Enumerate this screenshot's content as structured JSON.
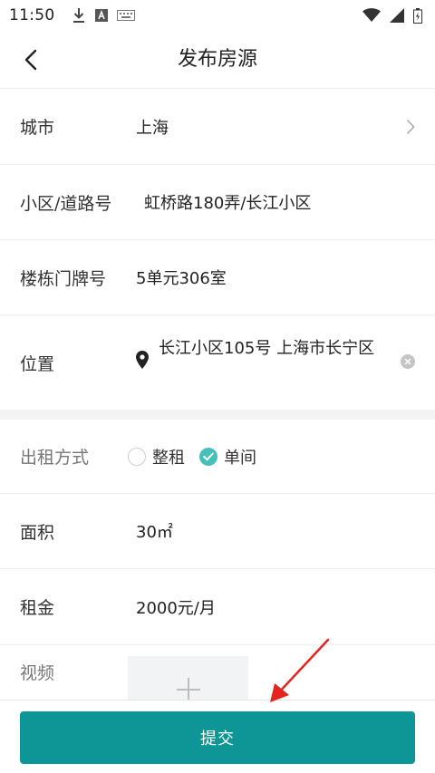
{
  "status_bar": {
    "time": "11:50",
    "left_icons": [
      "download-icon",
      "a-badge-icon",
      "keyboard-icon"
    ],
    "right_icons": [
      "wifi-icon",
      "signal-icon",
      "battery-icon"
    ]
  },
  "nav": {
    "title": "发布房源",
    "back_icon": "chevron-left-icon"
  },
  "form": {
    "city": {
      "label": "城市",
      "value": "上海"
    },
    "community": {
      "label": "小区/道路号",
      "value": "虹桥路180弄/长江小区"
    },
    "building": {
      "label": "楼栋门牌号",
      "value": "5单元306室"
    },
    "location": {
      "label": "位置",
      "value": "长江小区105号 上海市长宁区"
    },
    "rental_mode": {
      "label": "出租方式",
      "options": [
        "整租",
        "单间"
      ],
      "selected": "单间"
    },
    "area": {
      "label": "面积",
      "value": "30㎡"
    },
    "rent": {
      "label": "租金",
      "value": "2000元/月"
    },
    "video": {
      "label": "视频"
    }
  },
  "submit_label": "提交",
  "colors": {
    "accent": "#0e9596",
    "check": "#46c0b9",
    "annotation_arrow": "#e5231f"
  }
}
